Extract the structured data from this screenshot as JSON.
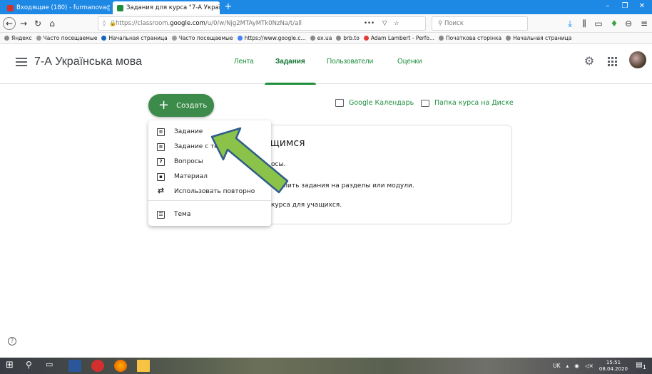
{
  "browser": {
    "tabs": [
      {
        "title": "Входящие (180) - furmanova@ ✕"
      },
      {
        "title": "Задания для курса \"7-А Украї ✕"
      }
    ],
    "new_tab": "+",
    "url_prefix": "https://classroom.",
    "url_domain": "google.com",
    "url_rest": "/u/0/w/Njg2MTAyMTk0NzNa/t/all",
    "url_more": "•••",
    "search_placeholder": "Поиск",
    "bookmarks": [
      "Яндекс",
      "Часто посещаемые",
      "Начальная страница",
      "Часто посещаемые",
      "https://www.google.c...",
      "ex.ua",
      "brb.to",
      "Adam Lambert - Perfo...",
      "Початкова сторінка",
      "Начальная страница"
    ]
  },
  "app": {
    "class_title": "7-А Українська мова",
    "tabs": [
      "Лента",
      "Задания",
      "Пользователи",
      "Оценки"
    ],
    "active_tab": "Задания"
  },
  "toolbar": {
    "create_label": "Создать",
    "calendar_label": "Google Календарь",
    "drive_label": "Папка курса на Диске"
  },
  "card": {
    "heading": "ащимся",
    "line1": "осы.",
    "line2": "аделить задания на разделы или модули.",
    "line3": "курса для учащихся."
  },
  "create_menu": {
    "items": [
      {
        "label": "Задание",
        "icon": "assignment-icon"
      },
      {
        "label": "Задание с те",
        "icon": "quiz-assignment-icon"
      },
      {
        "label": "Вопросы",
        "icon": "question-icon"
      },
      {
        "label": "Материал",
        "icon": "material-icon"
      },
      {
        "label": "Использовать повторно",
        "icon": "reuse-icon"
      },
      {
        "label": "Тема",
        "icon": "topic-icon"
      }
    ]
  },
  "taskbar": {
    "lang": "UK",
    "time": "15:51",
    "date": "08.04.2020",
    "notif_count": "1"
  },
  "colors": {
    "accent_green": "#1e8e3e",
    "create_button": "#3d8b4a",
    "arrow_fill": "#8bc34a",
    "arrow_stroke": "#2e5d8a",
    "browser_bar": "#1e88e5"
  }
}
